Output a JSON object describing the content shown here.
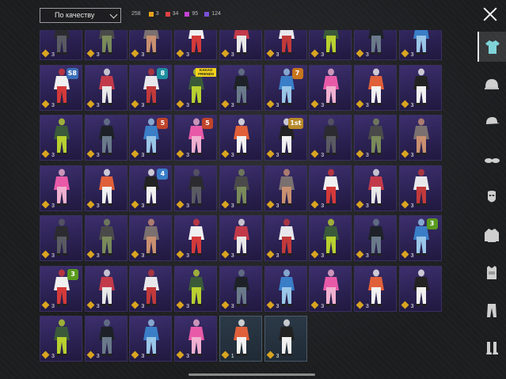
{
  "toolbar": {
    "sort_label": "По качеству",
    "total_count": "258",
    "counts": [
      {
        "value": "3",
        "color": "#e6a21d"
      },
      {
        "value": "34",
        "color": "#e04242"
      },
      {
        "value": "95",
        "color": "#c642d6"
      },
      {
        "value": "124",
        "color": "#7b4fd6"
      }
    ]
  },
  "sidebar": {
    "items": [
      {
        "icon": "outfit-icon",
        "active": true
      },
      {
        "icon": "helmet-icon",
        "active": false
      },
      {
        "icon": "cap-icon",
        "active": false
      },
      {
        "icon": "glasses-icon",
        "active": false
      },
      {
        "icon": "mask-icon",
        "active": false
      },
      {
        "icon": "jacket-icon",
        "active": false
      },
      {
        "icon": "vest-icon",
        "active": false
      },
      {
        "icon": "pants-icon",
        "active": false
      },
      {
        "icon": "boots-icon",
        "active": false
      }
    ]
  },
  "inventory": {
    "rows": [
      [
        {
          "qty": "3"
        },
        {
          "qty": "3"
        },
        {
          "qty": "3"
        },
        {
          "qty": "3"
        },
        {
          "qty": "3"
        },
        {
          "qty": "3"
        },
        {
          "qty": "3"
        },
        {
          "qty": "3"
        },
        {
          "qty": "3"
        }
      ],
      [
        {
          "qty": "3",
          "badge": "S8",
          "badge_color": "#3a6fb8"
        },
        {
          "qty": "3"
        },
        {
          "qty": "3",
          "badge": "8",
          "badge_color": "#1f8fa0"
        },
        {
          "qty": "3",
          "tag": "KAKAO FRIENDS"
        },
        {
          "qty": "3"
        },
        {
          "qty": "3",
          "badge": "7",
          "badge_color": "#c7761d"
        },
        {
          "qty": "3"
        },
        {
          "qty": "3"
        },
        {
          "qty": "3"
        }
      ],
      [
        {
          "qty": "3"
        },
        {
          "qty": "3"
        },
        {
          "qty": "3",
          "badge": "5",
          "badge_color": "#c0452a"
        },
        {
          "qty": "3",
          "badge": "5",
          "badge_color": "#c0452a"
        },
        {
          "qty": "3"
        },
        {
          "qty": "3",
          "badge": "1st",
          "badge_color": "#b8892a"
        },
        {
          "qty": "3"
        },
        {
          "qty": "3"
        },
        {
          "qty": "3"
        }
      ],
      [
        {
          "qty": "3"
        },
        {
          "qty": "3"
        },
        {
          "qty": "3",
          "badge": "4",
          "badge_color": "#3a7ec8"
        },
        {
          "qty": "3"
        },
        {
          "qty": "3"
        },
        {
          "qty": "3"
        },
        {
          "qty": "3"
        },
        {
          "qty": "3"
        },
        {
          "qty": "3"
        }
      ],
      [
        {
          "qty": "3"
        },
        {
          "qty": "3"
        },
        {
          "qty": "3"
        },
        {
          "qty": "3"
        },
        {
          "qty": "3"
        },
        {
          "qty": "3"
        },
        {
          "qty": "3"
        },
        {
          "qty": "3"
        },
        {
          "qty": "3",
          "badge": "3",
          "badge_color": "#5a9a1e"
        }
      ],
      [
        {
          "qty": "3",
          "badge": "3",
          "badge_color": "#5a9a1e"
        },
        {
          "qty": "3"
        },
        {
          "qty": "3"
        },
        {
          "qty": "3"
        },
        {
          "qty": "3"
        },
        {
          "qty": "3"
        },
        {
          "qty": "3"
        },
        {
          "qty": "3"
        },
        {
          "qty": "3"
        }
      ],
      [
        {
          "qty": "3"
        },
        {
          "qty": "3"
        },
        {
          "qty": "3"
        },
        {
          "qty": "3"
        },
        {
          "qty": "1",
          "dark": true
        },
        {
          "qty": "3",
          "dark": true
        }
      ]
    ]
  }
}
